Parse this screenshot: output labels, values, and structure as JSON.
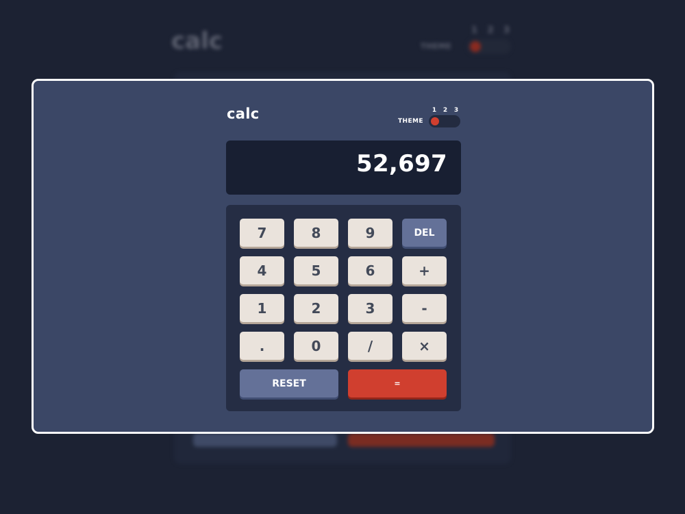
{
  "app": {
    "logo": "calc"
  },
  "theme": {
    "label": "THEME",
    "options": [
      "1",
      "2",
      "3"
    ],
    "active": 1
  },
  "display": {
    "value": "52,697"
  },
  "keys": {
    "k7": "7",
    "k8": "8",
    "k9": "9",
    "del": "DEL",
    "k4": "4",
    "k5": "5",
    "k6": "6",
    "plus": "+",
    "k1": "1",
    "k2": "2",
    "k3": "3",
    "minus": "-",
    "dot": ".",
    "k0": "0",
    "divide": "/",
    "multiply": "×",
    "reset": "RESET",
    "equals": "="
  },
  "colors": {
    "background": "#3b4766",
    "screen": "#181f32",
    "keypad": "#252d44",
    "key": "#eae3dc",
    "key_text": "#434a59",
    "function_key": "#647198",
    "accent": "#d03f2f"
  }
}
